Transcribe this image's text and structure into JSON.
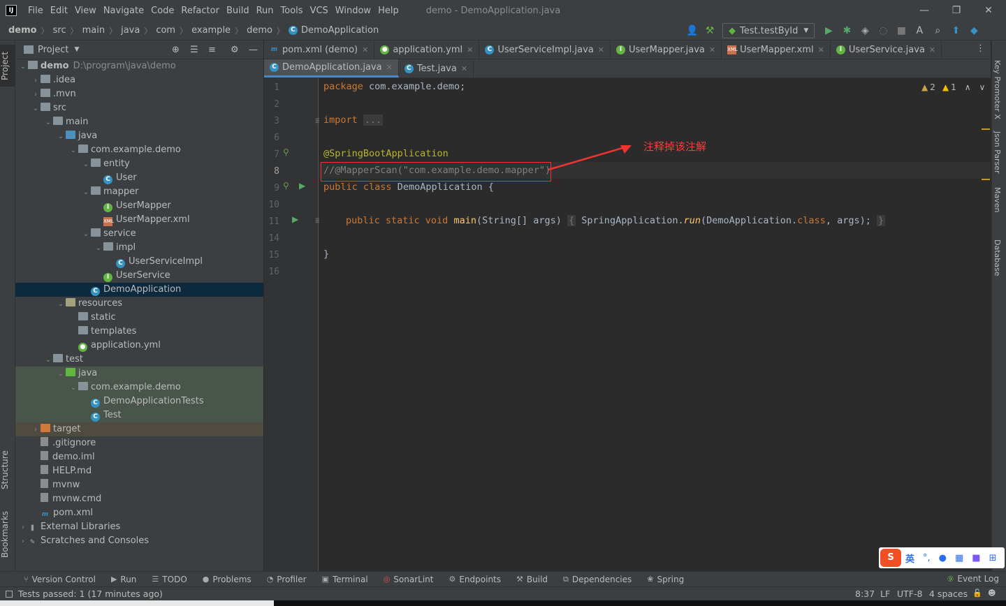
{
  "menubar": {
    "logo": "IJ",
    "items": [
      "File",
      "Edit",
      "View",
      "Navigate",
      "Code",
      "Refactor",
      "Build",
      "Run",
      "Tools",
      "VCS",
      "Window",
      "Help"
    ],
    "window_title": "demo - DemoApplication.java"
  },
  "navbar": {
    "crumbs": [
      "demo",
      "src",
      "main",
      "java",
      "com",
      "example",
      "demo",
      "DemoApplication"
    ],
    "run_config": "Test.testById"
  },
  "left_stripe": {
    "project": "Project",
    "structure": "Structure",
    "bookmarks": "Bookmarks"
  },
  "right_stripe": {
    "key_promoter": "Key Promoter X",
    "json_parser": "Json Parser",
    "maven": "Maven",
    "database": "Database"
  },
  "project_panel": {
    "title": "Project",
    "tree": [
      {
        "label": "demo",
        "extra": "D:\\program\\java\\demo",
        "depth": 0,
        "arrow": "down",
        "icon": "folder"
      },
      {
        "label": ".idea",
        "depth": 1,
        "arrow": "right",
        "icon": "folder"
      },
      {
        "label": ".mvn",
        "depth": 1,
        "arrow": "right",
        "icon": "folder"
      },
      {
        "label": "src",
        "depth": 1,
        "arrow": "down",
        "icon": "folder"
      },
      {
        "label": "main",
        "depth": 2,
        "arrow": "down",
        "icon": "folder"
      },
      {
        "label": "java",
        "depth": 3,
        "arrow": "down",
        "icon": "folder-src"
      },
      {
        "label": "com.example.demo",
        "depth": 4,
        "arrow": "down",
        "icon": "package"
      },
      {
        "label": "entity",
        "depth": 5,
        "arrow": "down",
        "icon": "package"
      },
      {
        "label": "User",
        "depth": 6,
        "icon": "class"
      },
      {
        "label": "mapper",
        "depth": 5,
        "arrow": "down",
        "icon": "package"
      },
      {
        "label": "UserMapper",
        "depth": 6,
        "icon": "interface"
      },
      {
        "label": "UserMapper.xml",
        "depth": 6,
        "icon": "xml"
      },
      {
        "label": "service",
        "depth": 5,
        "arrow": "down",
        "icon": "package"
      },
      {
        "label": "impl",
        "depth": 6,
        "arrow": "down",
        "icon": "package"
      },
      {
        "label": "UserServiceImpl",
        "depth": 7,
        "icon": "class"
      },
      {
        "label": "UserService",
        "depth": 6,
        "icon": "interface"
      },
      {
        "label": "DemoApplication",
        "depth": 5,
        "icon": "spring-class",
        "state": "selected"
      },
      {
        "label": "resources",
        "depth": 3,
        "arrow": "down",
        "icon": "folder-res"
      },
      {
        "label": "static",
        "depth": 4,
        "icon": "folder"
      },
      {
        "label": "templates",
        "depth": 4,
        "icon": "folder"
      },
      {
        "label": "application.yml",
        "depth": 4,
        "icon": "yml"
      },
      {
        "label": "test",
        "depth": 2,
        "arrow": "down",
        "icon": "folder"
      },
      {
        "label": "java",
        "depth": 3,
        "arrow": "down",
        "icon": "folder-test",
        "state": "test"
      },
      {
        "label": "com.example.demo",
        "depth": 4,
        "arrow": "down",
        "icon": "package",
        "state": "test"
      },
      {
        "label": "DemoApplicationTests",
        "depth": 5,
        "icon": "class",
        "state": "test"
      },
      {
        "label": "Test",
        "depth": 5,
        "icon": "class",
        "state": "test"
      },
      {
        "label": "target",
        "depth": 1,
        "arrow": "right",
        "icon": "folder-target",
        "state": "target"
      },
      {
        "label": ".gitignore",
        "depth": 1,
        "icon": "file"
      },
      {
        "label": "demo.iml",
        "depth": 1,
        "icon": "file"
      },
      {
        "label": "HELP.md",
        "depth": 1,
        "icon": "file"
      },
      {
        "label": "mvnw",
        "depth": 1,
        "icon": "file"
      },
      {
        "label": "mvnw.cmd",
        "depth": 1,
        "icon": "file"
      },
      {
        "label": "pom.xml",
        "depth": 1,
        "icon": "maven"
      },
      {
        "label": "External Libraries",
        "depth": 0,
        "arrow": "right",
        "icon": "libs"
      },
      {
        "label": "Scratches and Consoles",
        "depth": 0,
        "arrow": "right",
        "icon": "scratch"
      }
    ]
  },
  "editor_tabs_row1": [
    {
      "label": "pom.xml (demo)",
      "icon": "maven"
    },
    {
      "label": "application.yml",
      "icon": "yml"
    },
    {
      "label": "UserServiceImpl.java",
      "icon": "class"
    },
    {
      "label": "UserMapper.java",
      "icon": "interface"
    },
    {
      "label": "UserMapper.xml",
      "icon": "xml"
    },
    {
      "label": "UserService.java",
      "icon": "interface"
    }
  ],
  "editor_tabs_row2": [
    {
      "label": "DemoApplication.java",
      "icon": "spring-class",
      "active": true
    },
    {
      "label": "Test.java",
      "icon": "class",
      "active": false
    }
  ],
  "editor": {
    "line_numbers": [
      "1",
      "2",
      "3",
      "6",
      "7",
      "8",
      "9",
      "10",
      "11",
      "14",
      "15",
      "16"
    ],
    "pkg_kw": "package",
    "pkg_name": "com.example.demo;",
    "import_kw": "import",
    "import_fold": "...",
    "annotation": "@SpringBootApplication",
    "commented": "//@MapperScan(\"com.example.demo.mapper\")",
    "class_kw": "public class",
    "class_name": "DemoApplication",
    "brace_open": " {",
    "main_kw": "public static void",
    "main_name": "main",
    "main_params": "(String[] args)",
    "main_fold_open": "{",
    "main_body_pre": " SpringApplication.",
    "main_body_run": "run",
    "main_body_args": "(DemoApplication.",
    "main_body_class": "class",
    "main_body_end": ", args);",
    "main_fold_close": "}",
    "brace_close": "}",
    "inspections": {
      "warnings": "2",
      "weak_warnings": "1"
    }
  },
  "annotation_note": "注释掉该注解",
  "bottom_tools": [
    "Version Control",
    "Run",
    "TODO",
    "Problems",
    "Profiler",
    "Terminal",
    "SonarLint",
    "Endpoints",
    "Build",
    "Dependencies",
    "Spring"
  ],
  "event_log": "Event Log",
  "statusbar": {
    "message": "Tests passed: 1 (17 minutes ago)",
    "position": "8:37",
    "line_sep": "LF",
    "encoding": "UTF-8",
    "indent": "4 spaces"
  },
  "ime": {
    "lang": "英"
  }
}
